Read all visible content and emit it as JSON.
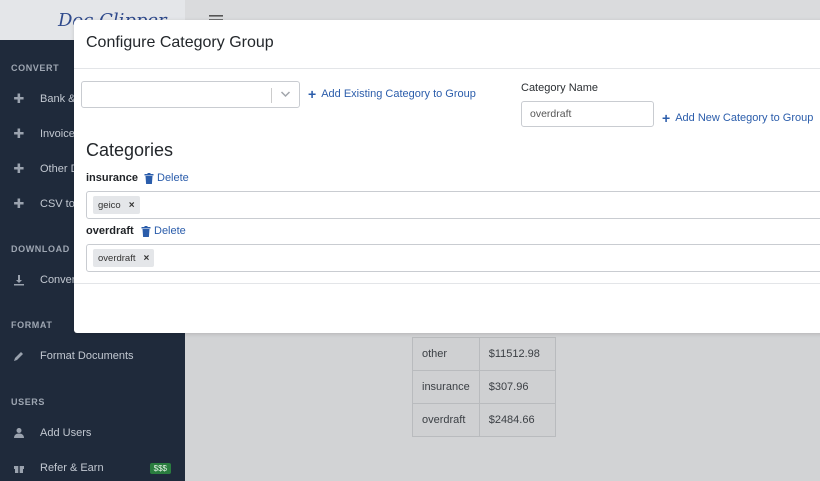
{
  "brand": {
    "logo_text": "Doc Clipper"
  },
  "sidebar": {
    "sections": {
      "convert": "CONVERT",
      "download": "DOWNLOAD",
      "format": "FORMAT",
      "users": "USERS"
    },
    "items": [
      {
        "label": "Bank & ",
        "icon": "plus-icon"
      },
      {
        "label": "Invoice",
        "icon": "plus-icon"
      },
      {
        "label": "Other D",
        "icon": "plus-icon"
      },
      {
        "label": "CSV to",
        "icon": "plus-icon"
      },
      {
        "label": "Conver",
        "icon": "download-icon"
      },
      {
        "label": "Format Documents",
        "icon": "pencil-icon"
      },
      {
        "label": "Add Users",
        "icon": "user-icon"
      },
      {
        "label": "Refer & Earn",
        "icon": "gift-icon",
        "badge": "$$$"
      }
    ]
  },
  "background_table": {
    "rows": [
      {
        "category": "other",
        "amount": "$11512.98"
      },
      {
        "category": "insurance",
        "amount": "$307.96"
      },
      {
        "category": "overdraft",
        "amount": "$2484.66"
      }
    ]
  },
  "modal": {
    "title": "Configure Category Group",
    "existing_select": {
      "value": ""
    },
    "add_existing_label": "Add Existing Category to Group",
    "category_name_label": "Category Name",
    "category_name_value": "overdraft",
    "add_new_label": "Add New Category to Group",
    "categories_heading": "Categories",
    "groups": [
      {
        "name": "insurance",
        "delete_label": "Delete",
        "tags": [
          "geico"
        ]
      },
      {
        "name": "overdraft",
        "delete_label": "Delete",
        "tags": [
          "overdraft"
        ]
      }
    ],
    "tag_remove_glyph": "×"
  },
  "colors": {
    "sidebar_bg": "#1f2a3b",
    "link_blue": "#2b5dab",
    "badge_green": "#2a7d3f"
  }
}
